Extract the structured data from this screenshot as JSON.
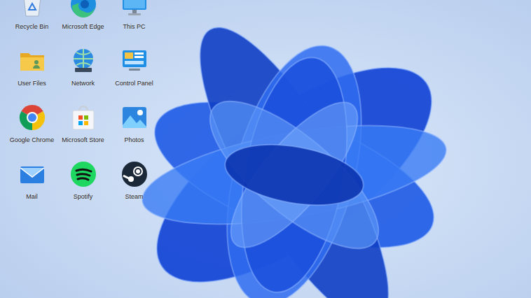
{
  "desktop": {
    "icons": [
      {
        "label": "Recycle Bin",
        "kind": "recycle"
      },
      {
        "label": "Microsoft Edge",
        "kind": "edge"
      },
      {
        "label": "This PC",
        "kind": "pc"
      },
      {
        "label": "User Files",
        "kind": "folder"
      },
      {
        "label": "Network",
        "kind": "network"
      },
      {
        "label": "Control Panel",
        "kind": "control"
      },
      {
        "label": "Google Chrome",
        "kind": "chrome"
      },
      {
        "label": "Microsoft Store",
        "kind": "store"
      },
      {
        "label": "Photos",
        "kind": "photos"
      },
      {
        "label": "Mail",
        "kind": "mail"
      },
      {
        "label": "Spotify",
        "kind": "spotify"
      },
      {
        "label": "Steam",
        "kind": "steam"
      }
    ]
  }
}
